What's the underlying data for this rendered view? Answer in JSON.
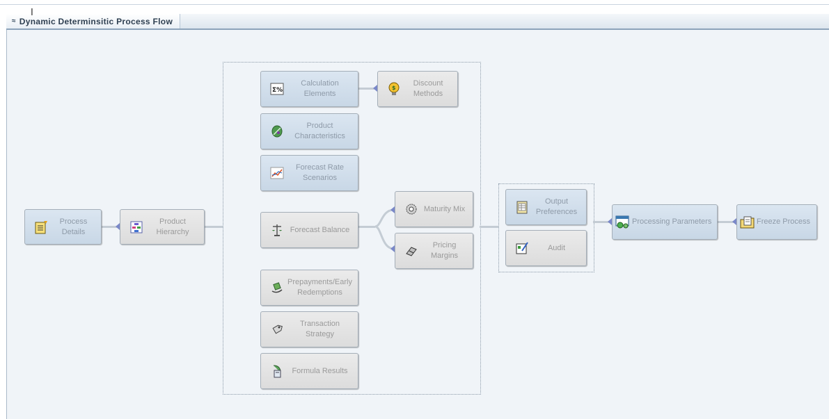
{
  "panel": {
    "title": "Dynamic Determinsitic Process Flow",
    "collapse_glyph": "≈"
  },
  "nodes": {
    "process_details": {
      "label": "Process Details",
      "icon": "document-edit-icon"
    },
    "product_hierarchy": {
      "label": "Product Hierarchy",
      "icon": "hierarchy-icon"
    },
    "calculation_elements": {
      "label": "Calculation Elements",
      "icon": "sigma-percent-icon"
    },
    "discount_methods": {
      "label": "Discount Methods",
      "icon": "money-bulb-icon"
    },
    "product_characteristics": {
      "label": "Product Characteristics",
      "icon": "leaf-icon"
    },
    "forecast_rate_scenarios": {
      "label": "Forecast Rate Scenarios",
      "icon": "line-chart-icon"
    },
    "forecast_balance": {
      "label": "Forecast Balance",
      "icon": "balance-icon"
    },
    "maturity_mix": {
      "label": "Maturity Mix",
      "icon": "gear-badge-icon"
    },
    "pricing_margins": {
      "label": "Pricing Margins",
      "icon": "eraser-icon"
    },
    "prepayments": {
      "label": "Prepayments/Early Redemptions",
      "icon": "money-hand-icon"
    },
    "transaction_strategy": {
      "label": "Transaction Strategy",
      "icon": "tag-icon"
    },
    "formula_results": {
      "label": "Formula Results",
      "icon": "calculator-leaf-icon"
    },
    "output_preferences": {
      "label": "Output Preferences",
      "icon": "document-grid-icon"
    },
    "audit": {
      "label": "Audit",
      "icon": "audit-edit-icon"
    },
    "processing_parameters": {
      "label": "Processing Parameters",
      "icon": "window-gears-icon"
    },
    "freeze_process": {
      "label": "Freeze Process",
      "icon": "folder-document-icon"
    }
  },
  "colors": {
    "node_blue": "#c8d7e6",
    "node_gray": "#dcdcdc",
    "connector_arrow": "#7a88c9",
    "label_text": "#8e9aa8"
  }
}
